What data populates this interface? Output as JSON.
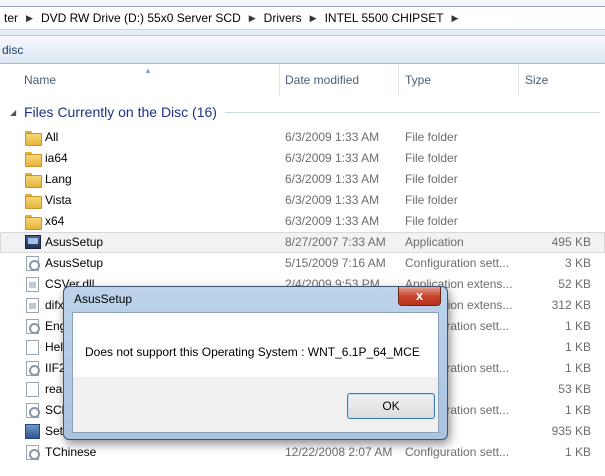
{
  "address": {
    "crumbs": [
      "ter",
      "DVD RW Drive (D:) 55x0 Server SCD",
      "Drivers",
      "INTEL 5500 CHIPSET"
    ]
  },
  "toolbar": {
    "label": "disc"
  },
  "columns": {
    "name": "Name",
    "date": "Date modified",
    "type": "Type",
    "size": "Size"
  },
  "group": {
    "title": "Files Currently on the Disc (16)"
  },
  "files": [
    {
      "icon": "folder-icon",
      "name": "All",
      "date": "6/3/2009 1:33 AM",
      "type": "File folder",
      "size": ""
    },
    {
      "icon": "folder-icon",
      "name": "ia64",
      "date": "6/3/2009 1:33 AM",
      "type": "File folder",
      "size": ""
    },
    {
      "icon": "folder-icon",
      "name": "Lang",
      "date": "6/3/2009 1:33 AM",
      "type": "File folder",
      "size": ""
    },
    {
      "icon": "folder-icon",
      "name": "Vista",
      "date": "6/3/2009 1:33 AM",
      "type": "File folder",
      "size": ""
    },
    {
      "icon": "folder-icon",
      "name": "x64",
      "date": "6/3/2009 1:33 AM",
      "type": "File folder",
      "size": ""
    },
    {
      "icon": "application-icon",
      "name": "AsusSetup",
      "date": "8/27/2007 7:33 AM",
      "type": "Application",
      "size": "495 KB"
    },
    {
      "icon": "config-file-icon",
      "name": "AsusSetup",
      "date": "5/15/2009 7:16 AM",
      "type": "Configuration sett...",
      "size": "3 KB"
    },
    {
      "icon": "dll-file-icon",
      "name": "CSVer.dll",
      "date": "2/4/2009 9:53 PM",
      "type": "Application extens...",
      "size": "52 KB"
    },
    {
      "icon": "dll-file-icon",
      "name": "difx",
      "date": "",
      "type": "Application extens...",
      "size": "312 KB"
    },
    {
      "icon": "config-file-icon",
      "name": "Eng",
      "date": "",
      "type": "Configuration sett...",
      "size": "1 KB"
    },
    {
      "icon": "document-icon",
      "name": "Hel",
      "date": "",
      "type": "cument",
      "size": "1 KB"
    },
    {
      "icon": "config-file-icon",
      "name": "IIF2",
      "date": "",
      "type": "Configuration sett...",
      "size": "1 KB"
    },
    {
      "icon": "document-icon",
      "name": "rea",
      "date": "",
      "type": "cument",
      "size": "53 KB"
    },
    {
      "icon": "config-file-icon",
      "name": "SCh",
      "date": "",
      "type": "Configuration sett...",
      "size": "1 KB"
    },
    {
      "icon": "setup-icon",
      "name": "Set",
      "date": "",
      "type": "n",
      "size": "935 KB"
    },
    {
      "icon": "config-file-icon",
      "name": "TChinese",
      "date": "12/22/2008 2:07 AM",
      "type": "Configuration sett...",
      "size": "1 KB"
    }
  ],
  "dialog": {
    "title": "AsusSetup",
    "close_glyph": "x",
    "message": "Does not support this Operating System : WNT_6.1P_64_MCE",
    "ok_label": "OK"
  }
}
